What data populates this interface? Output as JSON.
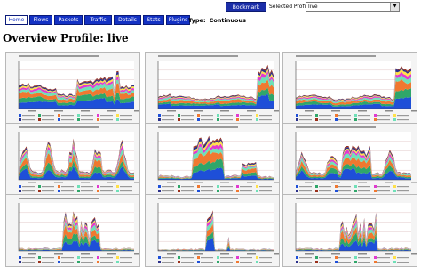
{
  "header": {
    "bookmark_label": "Bookmark URL",
    "selected_profile_label": "Selected Profile:",
    "selected_profile_value": "live"
  },
  "tabs": [
    {
      "label": "Home",
      "active": true
    },
    {
      "label": "Flows",
      "active": false
    },
    {
      "label": "Packets",
      "active": false
    },
    {
      "label": "Traffic",
      "active": false
    },
    {
      "label": "Details",
      "active": false
    },
    {
      "label": "Stats",
      "active": false
    },
    {
      "label": "Plugins",
      "active": false
    }
  ],
  "type": {
    "label": "Type:",
    "value": "Continuous"
  },
  "page_title": "Overview Profile: live",
  "colors": {
    "accent": "#1432c4",
    "series": [
      "#1e4fd8",
      "#2fa66a",
      "#f07830",
      "#6fe0b8",
      "#e03ad0",
      "#ffe14a",
      "#2a2f8a",
      "#9a2f1a"
    ]
  },
  "chart_data": [
    {
      "type": "area",
      "row": 1,
      "metric": "Flows/s",
      "shape": "wide-plateau"
    },
    {
      "type": "area",
      "row": 1,
      "metric": "Packets/s",
      "shape": "flat-spike-end"
    },
    {
      "type": "area",
      "row": 1,
      "metric": "Bits/s",
      "shape": "flat-spike-end"
    },
    {
      "type": "area",
      "row": 2,
      "metric": "Flows/s",
      "shape": "daily-waves"
    },
    {
      "type": "area",
      "row": 2,
      "metric": "Packets/s",
      "shape": "block-center"
    },
    {
      "type": "area",
      "row": 2,
      "metric": "Bits/s",
      "shape": "daily-waves-block"
    },
    {
      "type": "area",
      "row": 3,
      "metric": "Flows/s",
      "shape": "bursty-center"
    },
    {
      "type": "area",
      "row": 3,
      "metric": "Packets/s",
      "shape": "sparse-spikes"
    },
    {
      "type": "area",
      "row": 3,
      "metric": "Bits/s",
      "shape": "bursty-center"
    }
  ]
}
